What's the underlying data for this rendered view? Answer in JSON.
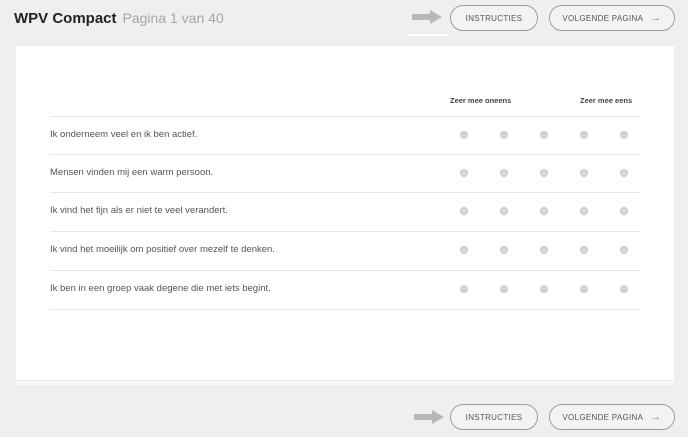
{
  "header": {
    "app_title": "WPV Compact",
    "page_indicator": "Pagina 1 van 40"
  },
  "buttons": {
    "instructions_label": "INSTRUCTIES",
    "next_label": "VOLGENDE PAGINA",
    "next_icon": "arrow-right-icon"
  },
  "scale": {
    "left_label": "Zeer mee oneens",
    "right_label": "Zeer mee eens",
    "options_count": 5
  },
  "questions": [
    {
      "text": "Ik onderneem veel en ik ben actief."
    },
    {
      "text": "Mensen vinden mij een warm persoon."
    },
    {
      "text": "Ik vind het fijn als er niet te veel verandert."
    },
    {
      "text": "Ik vind het moeilijk om positief over mezelf te denken."
    },
    {
      "text": "Ik ben in een groep vaak degene die met iets begint."
    }
  ],
  "colors": {
    "background": "#efefef",
    "card": "#ffffff",
    "radio": "#d6d6d6",
    "arrow_hint": "#b8b8b8"
  }
}
